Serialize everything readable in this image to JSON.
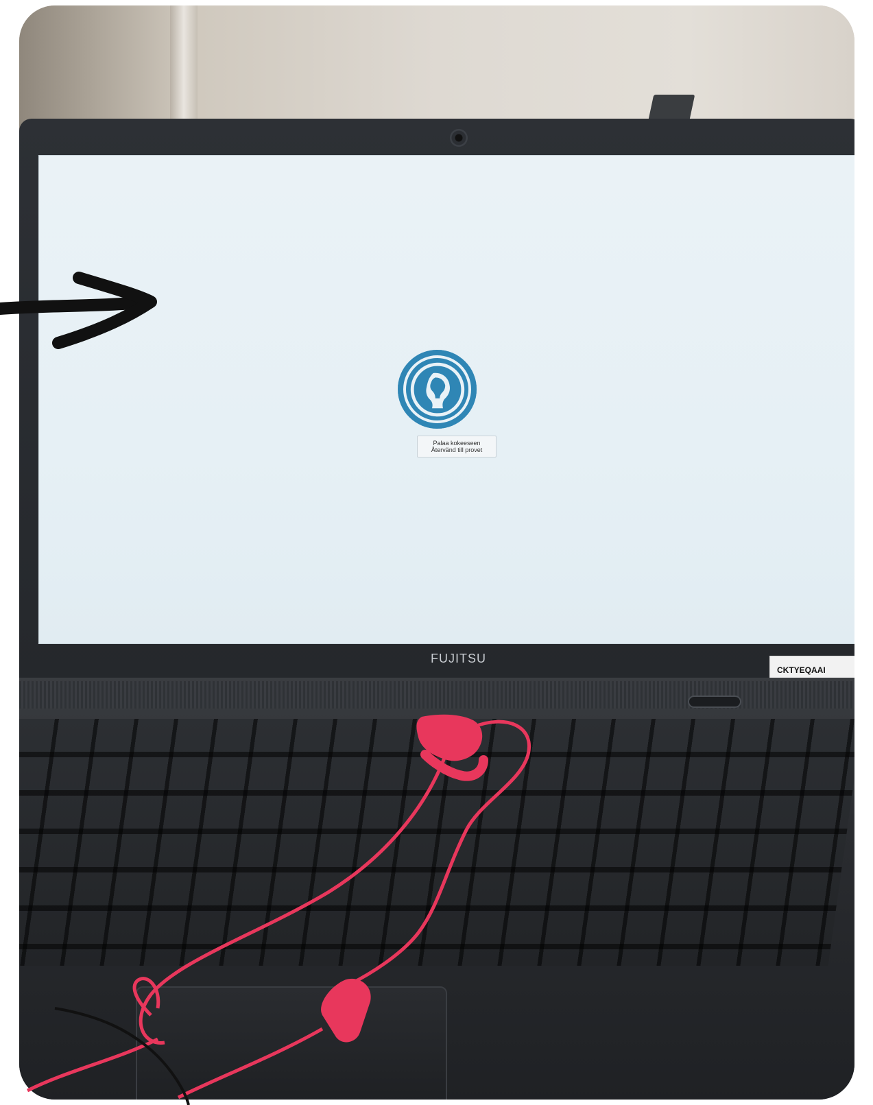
{
  "screen": {
    "return_button": {
      "line1": "Palaa kokeeseen",
      "line2": "Återvänd till provet"
    },
    "logo_icon": "helmeted-head-profile-icon"
  },
  "laptop": {
    "brand": "FUJITSU",
    "sticker_text": "CKTYEQAAI"
  },
  "annotation": {
    "arrow_icon": "black-hand-drawn-arrow-icon"
  },
  "colors": {
    "screen_bg": "#e6f0f5",
    "logo_blue": "#2f86b5",
    "cable_pink": "#e8375c",
    "arrow": "#111111"
  }
}
